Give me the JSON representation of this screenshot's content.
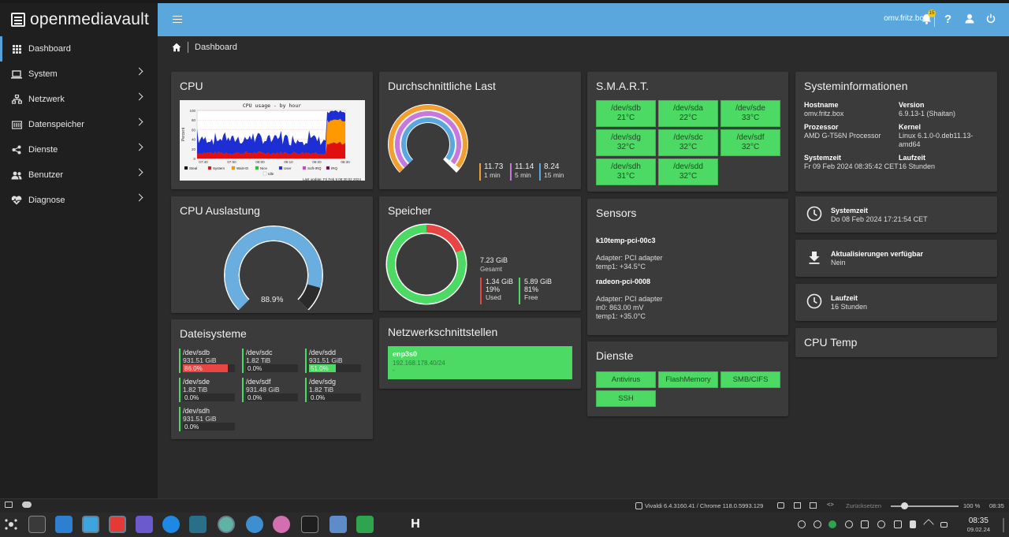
{
  "app": {
    "logo_text": "openmediavault"
  },
  "sidebar": {
    "items": [
      {
        "label": "Dashboard"
      },
      {
        "label": "System"
      },
      {
        "label": "Netzwerk"
      },
      {
        "label": "Datenspeicher"
      },
      {
        "label": "Dienste"
      },
      {
        "label": "Benutzer"
      },
      {
        "label": "Diagnose"
      }
    ]
  },
  "topbar": {
    "hostname": "omv.fritz.box",
    "notification_count": "15"
  },
  "breadcrumb": {
    "current": "Dashboard"
  },
  "cpu": {
    "title": "CPU",
    "graph_title": "CPU usage - by hour",
    "graph_ylabel": "Percent",
    "y_ticks": [
      "100",
      "80",
      "60",
      "40",
      "20",
      "0"
    ],
    "x_ticks": [
      "07:40",
      "07:50",
      "08:00",
      "08:10",
      "08:20",
      "08:30"
    ],
    "legend": [
      "Steal",
      "System",
      "Wait-IO",
      "Nice",
      "User",
      "Soft-IRQ",
      "IRQ",
      "Idle"
    ],
    "last_update": "Last update: Fri Feb  9 08:30:02 2024"
  },
  "load": {
    "title": "Durchschnittliche Last",
    "values": [
      {
        "value": "11.73",
        "label": "1 min",
        "color": "#f0a030",
        "fraction": 0.97
      },
      {
        "value": "11.14",
        "label": "5 min",
        "color": "#c678dd",
        "fraction": 0.97
      },
      {
        "value": "8.24",
        "label": "15 min",
        "color": "#5aa7de",
        "fraction": 0.97
      }
    ]
  },
  "smart": {
    "title": "S.M.A.R.T.",
    "disks": [
      {
        "dev": "/dev/sdb",
        "temp": "21°C"
      },
      {
        "dev": "/dev/sda",
        "temp": "22°C"
      },
      {
        "dev": "/dev/sde",
        "temp": "33°C"
      },
      {
        "dev": "/dev/sdg",
        "temp": "32°C"
      },
      {
        "dev": "/dev/sdc",
        "temp": "32°C"
      },
      {
        "dev": "/dev/sdf",
        "temp": "32°C"
      },
      {
        "dev": "/dev/sdh",
        "temp": "31°C"
      },
      {
        "dev": "/dev/sdd",
        "temp": "32°C"
      }
    ]
  },
  "sysinfo": {
    "title": "Systeminformationen",
    "hostname_label": "Hostname",
    "hostname": "omv.fritz.box",
    "version_label": "Version",
    "version": "6.9.13-1 (Shaitan)",
    "cpu_label": "Prozessor",
    "cpu": "AMD G-T56N Processor",
    "kernel_label": "Kernel",
    "kernel": "Linux 6.1.0-0.deb11.13-amd64",
    "time_label": "Systemzeit",
    "time": "Fr 09 Feb 2024 08:35:42 CET",
    "uptime_label": "Laufzeit",
    "uptime": "16 Stunden"
  },
  "cpu_usage": {
    "title": "CPU Auslastung",
    "value_text": "88.9%",
    "fraction": 0.889
  },
  "memory": {
    "title": "Speicher",
    "total": "7.23 GiB",
    "total_label": "Gesamt",
    "used": "1.34 GiB",
    "used_pct": "19%",
    "used_label": "Used",
    "free": "5.89 GiB",
    "free_pct": "81%",
    "free_label": "Free",
    "used_fraction": 0.19
  },
  "sensors": {
    "title": "Sensors",
    "blocks": [
      {
        "name": "k10temp-pci-00c3",
        "lines": [
          "Adapter: PCI adapter",
          "temp1: +34.5°C"
        ]
      },
      {
        "name": "radeon-pci-0008",
        "lines": [
          "Adapter: PCI adapter",
          "in0: 863.00 mV",
          "temp1: +35.0°C"
        ]
      }
    ]
  },
  "systime_card": {
    "title": "Systemzeit",
    "value": "Do 08 Feb 2024 17:21:54 CET"
  },
  "updates_card": {
    "title": "Aktualisierungen verfügbar",
    "value": "Nein"
  },
  "uptime_card": {
    "title": "Laufzeit",
    "value": "16 Stunden"
  },
  "cputemp_card": {
    "title": "CPU Temp"
  },
  "filesystems": {
    "title": "Dateisysteme",
    "items": [
      {
        "dev": "/dev/sdb",
        "size": "931.51 GiB",
        "pct": "86.0%",
        "fraction": 0.86,
        "color": "#e84545"
      },
      {
        "dev": "/dev/sdc",
        "size": "1.82 TiB",
        "pct": "0.0%",
        "fraction": 0.0,
        "color": "#4cd964"
      },
      {
        "dev": "/dev/sdd",
        "size": "931.51 GiB",
        "pct": "51.0%",
        "fraction": 0.51,
        "color": "#4cd964"
      },
      {
        "dev": "/dev/sde",
        "size": "1.82 TiB",
        "pct": "0.0%",
        "fraction": 0.0,
        "color": "#4cd964"
      },
      {
        "dev": "/dev/sdf",
        "size": "931.48 GiB",
        "pct": "0.0%",
        "fraction": 0.0,
        "color": "#4cd964"
      },
      {
        "dev": "/dev/sdg",
        "size": "1.82 TiB",
        "pct": "0.0%",
        "fraction": 0.0,
        "color": "#4cd964"
      },
      {
        "dev": "/dev/sdh",
        "size": "931.51 GiB",
        "pct": "0.0%",
        "fraction": 0.0,
        "color": "#4cd964"
      }
    ]
  },
  "network": {
    "title": "Netzwerkschnittstellen",
    "iface": "enp3s0",
    "ip": "192.168.178.40/24",
    "extra": "-"
  },
  "services": {
    "title": "Dienste",
    "items": [
      "Antivirus",
      "FlashMemory",
      "SMB/CIFS",
      "SSH"
    ]
  },
  "browser_status": {
    "version": "Vivaldi 6.4.3160.41 / Chrome 118.0.5993.129",
    "reset": "Zurücksetzen",
    "zoom": "100 %",
    "time": "08:35"
  },
  "taskbar": {
    "clock_time": "08:35",
    "clock_date": "09.02.24"
  },
  "colors": {
    "accent": "#5aa7de",
    "ok": "#4cd964",
    "warn": "#e84545",
    "card": "#3b3b3b"
  }
}
